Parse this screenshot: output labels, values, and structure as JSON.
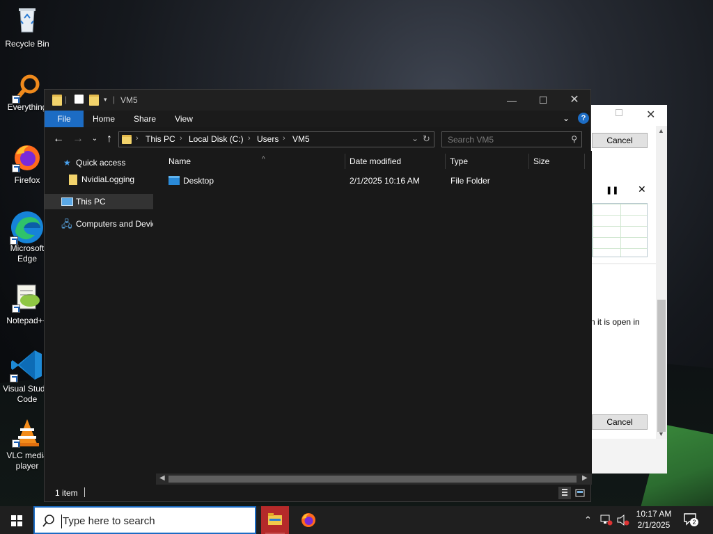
{
  "desktop": {
    "icons": [
      {
        "label": "Recycle Bin"
      },
      {
        "label": "Everything"
      },
      {
        "label": "Firefox"
      },
      {
        "label": "Microsoft Edge"
      },
      {
        "label": "Notepad++"
      },
      {
        "label": "Visual Studio Code"
      },
      {
        "label": "VLC media player"
      }
    ]
  },
  "background_dialog": {
    "cancel_top": "Cancel",
    "cancel_bottom": "Cancel",
    "partial_text": "n it is open in"
  },
  "explorer": {
    "title": "VM5",
    "ribbon": {
      "file": "File",
      "home": "Home",
      "share": "Share",
      "view": "View",
      "help": "?"
    },
    "address": {
      "this_pc": "This PC",
      "local_disk": "Local Disk (C:)",
      "users": "Users",
      "folder": "VM5"
    },
    "search_placeholder": "Search VM5",
    "nav": {
      "quick_access": "Quick access",
      "nvidia_logging": "NvidiaLogging",
      "this_pc": "This PC",
      "computers": "Computers and Devices"
    },
    "columns": {
      "name": "Name",
      "date": "Date modified",
      "type": "Type",
      "size": "Size"
    },
    "rows": [
      {
        "name": "Desktop",
        "date": "2/1/2025 10:16 AM",
        "type": "File Folder",
        "size": ""
      }
    ],
    "status": "1 item"
  },
  "taskbar": {
    "search_placeholder": "Type here to search",
    "time": "10:17 AM",
    "date": "2/1/2025",
    "notification_count": "2"
  }
}
